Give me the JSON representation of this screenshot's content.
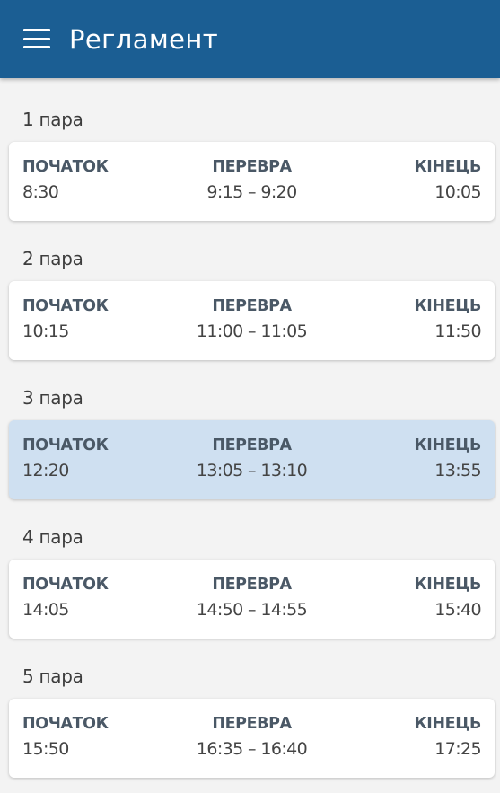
{
  "app_bar": {
    "title": "Регламент",
    "menu_icon": "hamburger-menu-icon",
    "background": "#1b5e93"
  },
  "labels": {
    "start": "ПОЧАТОК",
    "break": "ПЕРЕВРА",
    "end": "КІНЕЦЬ"
  },
  "lessons": [
    {
      "name": "1 пара",
      "start": "8:30",
      "break": "9:15 – 9:20",
      "end": "10:05",
      "active": false
    },
    {
      "name": "2 пара",
      "start": "10:15",
      "break": "11:00 – 11:05",
      "end": "11:50",
      "active": false
    },
    {
      "name": "3 пара",
      "start": "12:20",
      "break": "13:05 – 13:10",
      "end": "13:55",
      "active": true
    },
    {
      "name": "4 пара",
      "start": "14:05",
      "break": "14:50 – 14:55",
      "end": "15:40",
      "active": false
    },
    {
      "name": "5 пара",
      "start": "15:50",
      "break": "16:35 – 16:40",
      "end": "17:25",
      "active": false
    }
  ],
  "colors": {
    "active_card": "#cfe0f1",
    "card": "#ffffff",
    "page_background": "#f3f3f3"
  }
}
